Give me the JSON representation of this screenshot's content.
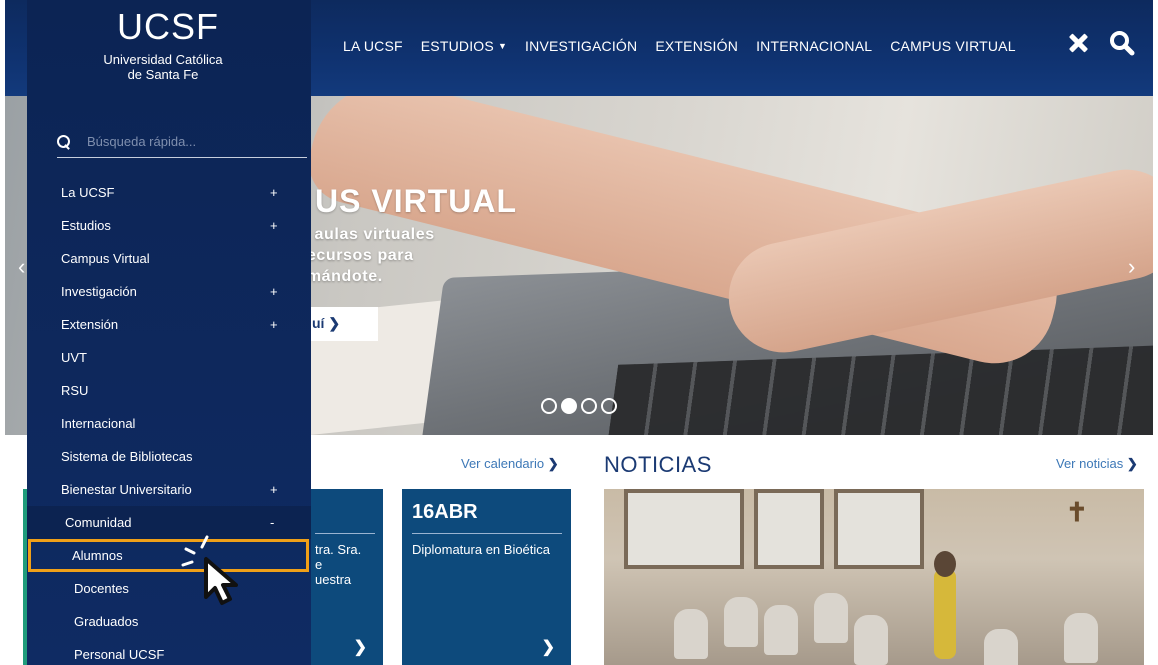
{
  "topbar": {
    "nav": [
      "LA UCSF",
      "ESTUDIOS",
      "INVESTIGACIÓN",
      "EXTENSIÓN",
      "INTERNACIONAL",
      "CAMPUS VIRTUAL"
    ],
    "close_icon": "close-icon",
    "search_icon": "search-icon"
  },
  "logo": {
    "title": "UCSF",
    "subtitle_line1": "Universidad Católica",
    "subtitle_line2": "de Santa Fe"
  },
  "sidebar": {
    "search_placeholder": "Búsqueda rápida...",
    "items": [
      {
        "label": "La UCSF",
        "toggle": "+"
      },
      {
        "label": "Estudios",
        "toggle": "+"
      },
      {
        "label": "Campus Virtual",
        "toggle": ""
      },
      {
        "label": "Investigación",
        "toggle": "+"
      },
      {
        "label": "Extensión",
        "toggle": "+"
      },
      {
        "label": "UVT",
        "toggle": ""
      },
      {
        "label": "RSU",
        "toggle": ""
      },
      {
        "label": "Internacional",
        "toggle": ""
      },
      {
        "label": "Sistema de Bibliotecas",
        "toggle": ""
      },
      {
        "label": "Bienestar Universitario",
        "toggle": "+"
      },
      {
        "label": "Comunidad",
        "toggle": "-"
      }
    ],
    "subitems": [
      "Alumnos",
      "Docentes",
      "Graduados",
      "Personal UCSF"
    ]
  },
  "hero": {
    "title": "US VIRTUAL",
    "subtitle_line1": "s aulas virtuales",
    "subtitle_line2": "recursos para",
    "subtitle_line3": "rmándote.",
    "button_label": "uí",
    "active_slide": 2,
    "slide_count": 4
  },
  "events": {
    "link_label": "Ver calendario",
    "card_a_text_line1": "tra. Sra.",
    "card_a_text_line2": "e",
    "card_a_text_line3": "uestra",
    "card_b_date": "16ABR",
    "card_b_text": "Diplomatura en Bioética"
  },
  "news": {
    "title": "NOTICIAS",
    "link_label": "Ver noticias"
  },
  "colors": {
    "navy": "#0f2b63",
    "highlight": "#f0a018",
    "card": "#0d4a7c",
    "accent_green": "#1f9c7b"
  }
}
